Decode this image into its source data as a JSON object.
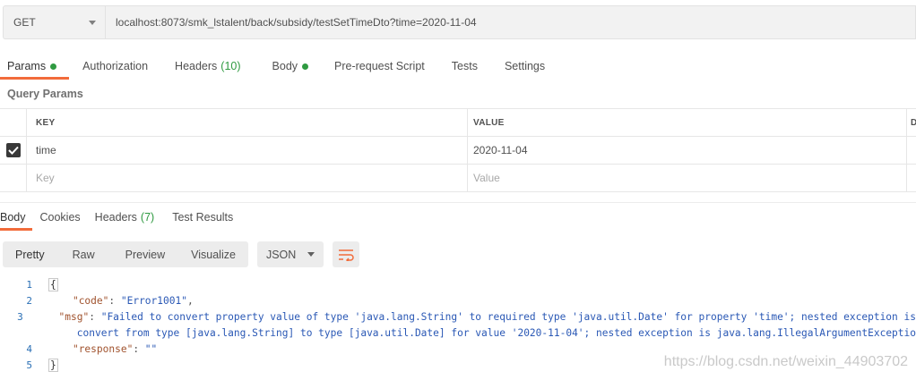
{
  "request": {
    "method": "GET",
    "url": "localhost:8073/smk_lstalent/back/subsidy/testSetTimeDto?time=2020-11-04"
  },
  "request_tabs": {
    "params": "Params",
    "authorization": "Authorization",
    "headers": "Headers",
    "headers_count": "(10)",
    "body": "Body",
    "prerequest": "Pre-request Script",
    "tests": "Tests",
    "settings": "Settings"
  },
  "query_params": {
    "title": "Query Params",
    "columns": {
      "key": "KEY",
      "value": "VALUE",
      "extra": "D"
    },
    "rows": [
      {
        "key": "time",
        "value": "2020-11-04",
        "checked": true
      }
    ],
    "placeholder": {
      "key": "Key",
      "value": "Value"
    }
  },
  "response_tabs": {
    "body": "Body",
    "cookies": "Cookies",
    "headers": "Headers",
    "headers_count": "(7)",
    "test_results": "Test Results"
  },
  "view_modes": {
    "pretty": "Pretty",
    "raw": "Raw",
    "preview": "Preview",
    "visualize": "Visualize"
  },
  "format": "JSON",
  "response_lines": {
    "n1": "1",
    "n2": "2",
    "n3": "3",
    "n4": "4",
    "n5": "5",
    "open_brace": "{",
    "close_brace": "}",
    "code_key": "\"code\"",
    "code_value": "\"Error1001\"",
    "msg_key": "\"msg\"",
    "msg_value_1": "\"Failed to convert property value of type 'java.lang.String' to required type 'java.util.Date' for property 'time'; nested exception is",
    "msg_value_2": "convert from type [java.lang.String] to type [java.util.Date] for value '2020-11-04'; nested exception is java.lang.IllegalArgumentExceptio",
    "response_key": "\"response\"",
    "response_value": "\"\""
  },
  "watermark": "https://blog.csdn.net/weixin_44903702",
  "colors": {
    "accent": "#f26b3a",
    "count_green": "#2f9a41"
  }
}
